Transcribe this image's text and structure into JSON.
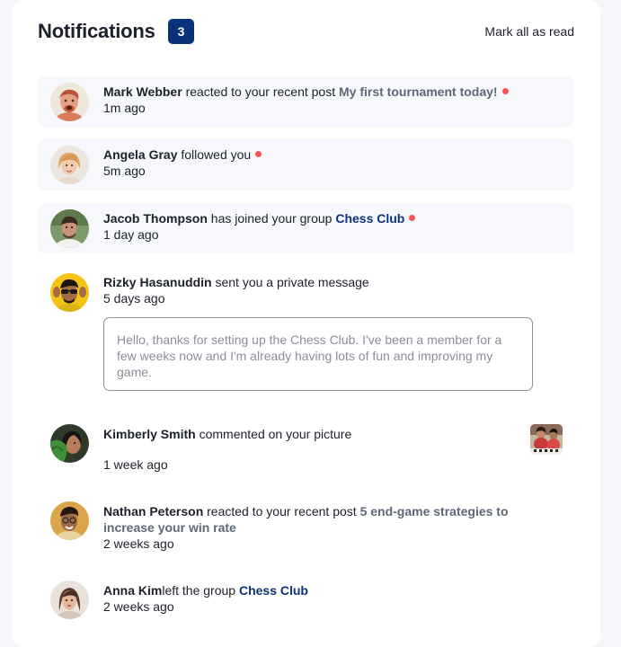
{
  "header": {
    "title": "Notifications",
    "count": "3",
    "mark_all": "Mark all as read"
  },
  "notifications": [
    {
      "name": "Mark Webber",
      "action": "reacted to your recent post",
      "target": "My first tournament today!",
      "time": "1m ago",
      "unread": true
    },
    {
      "name": "Angela Gray",
      "action": "followed you",
      "time": "5m ago",
      "unread": true
    },
    {
      "name": "Jacob Thompson",
      "action": "has joined your group",
      "target": "Chess Club",
      "time": "1 day ago",
      "unread": true
    },
    {
      "name": "Rizky Hasanuddin",
      "action": "sent you a private message",
      "time": "5 days ago",
      "message": "Hello, thanks for setting up the Chess Club. I've been a member for a few weeks now and I'm already having lots of fun and improving my game.",
      "unread": false
    },
    {
      "name": "Kimberly Smith",
      "action": "commented on your picture",
      "time": "1 week ago",
      "unread": false
    },
    {
      "name": "Nathan Peterson",
      "action": "reacted to your recent post",
      "target": "5 end-game strategies to increase your win rate",
      "time": "2 weeks ago",
      "unread": false
    },
    {
      "name": "Anna Kim",
      "action": "left the group",
      "target": "Chess Club",
      "time": "2 weeks ago",
      "unread": false
    }
  ],
  "colors": {
    "badge": "#0a327b",
    "dot": "#f65552",
    "group_link": "#0a327b",
    "unread_bg": "#f6f8fb",
    "page_bg": "#f4f6fa"
  }
}
